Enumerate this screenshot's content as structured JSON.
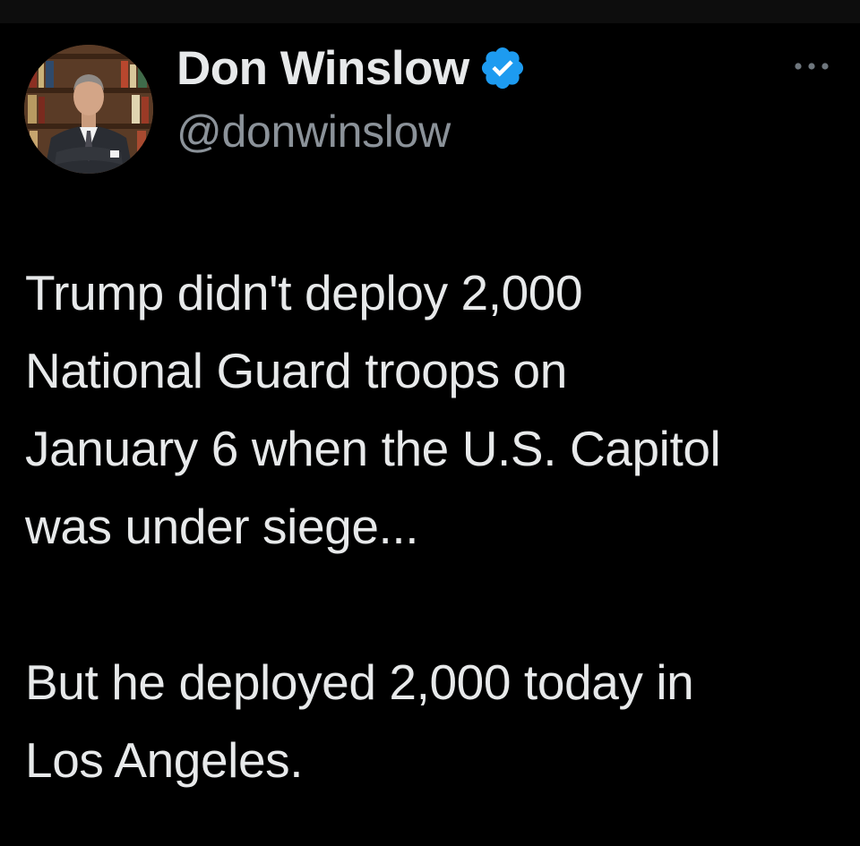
{
  "tweet": {
    "author": {
      "display_name": "Don Winslow",
      "handle": "@donwinslow",
      "verified": true,
      "verified_color": "#1d9bf0"
    },
    "text": "Trump didn't deploy 2,000\nNational Guard troops on\nJanuary 6 when the U.S. Capitol\nwas under siege...\n\nBut he deployed 2,000 today in\nLos Angeles.",
    "more_icon": "more-horizontal-icon"
  },
  "theme": {
    "background": "#000000",
    "text": "#e7e9ea",
    "secondary_text": "#8b9299"
  }
}
